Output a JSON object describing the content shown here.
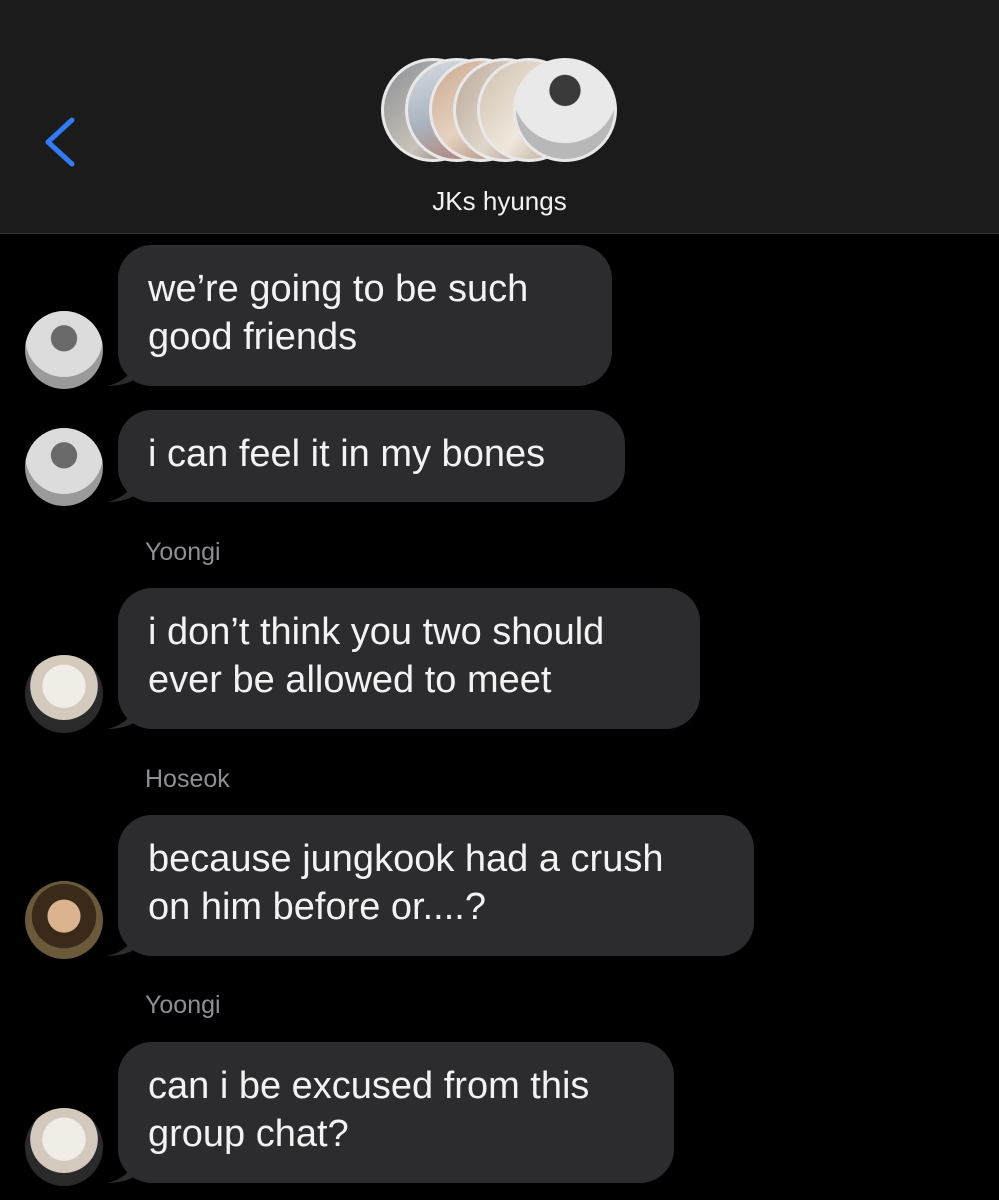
{
  "header": {
    "group_name": "JKs hyungs",
    "back_icon": "chevron-left-icon",
    "accent_color": "#2f7cf6"
  },
  "messages": [
    {
      "sender": "",
      "text_lines": [
        "we’re going to be such",
        "good friends"
      ],
      "avatar": "jin"
    },
    {
      "sender": "",
      "text_lines": [
        "i can feel it in my bones"
      ],
      "avatar": "jin"
    },
    {
      "sender": "Yoongi",
      "text_lines": [
        "i don’t think you two should",
        "ever be allowed to meet"
      ],
      "avatar": "yoongi"
    },
    {
      "sender": "Hoseok",
      "text_lines": [
        "because jungkook had a crush",
        "on him before or....?"
      ],
      "avatar": "hoseok"
    },
    {
      "sender": "Yoongi",
      "text_lines": [
        "can i be excused from this",
        "group chat?"
      ],
      "avatar": "yoongi"
    }
  ],
  "colors": {
    "header_bg": "#1b1b1c",
    "bubble_bg": "#2c2c2e",
    "text": "#f2f2f2",
    "sender_text": "#8e8e93"
  }
}
